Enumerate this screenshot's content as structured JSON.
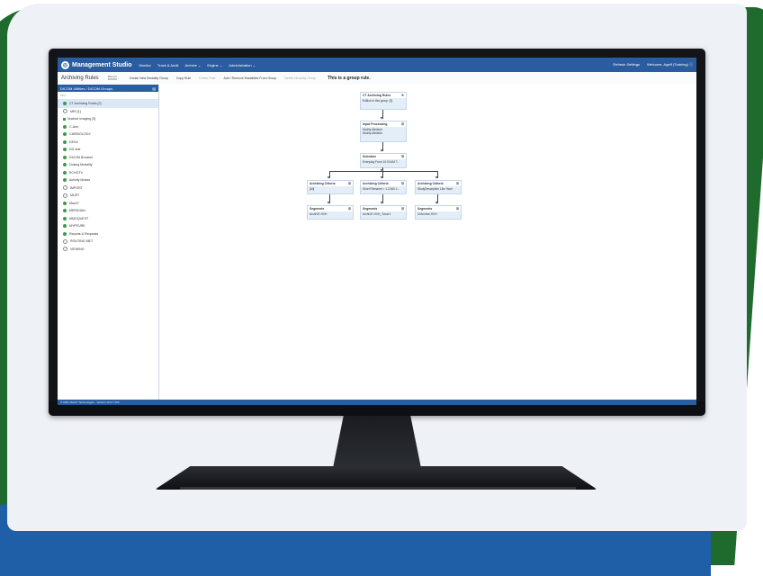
{
  "app": {
    "name": "Management Studio",
    "nav": [
      "Monitor",
      "Track & Audit",
      "Archive ⌄",
      "Engine ⌄",
      "Administration ⌄"
    ],
    "top_right": [
      "Refresh Settings",
      "Welcome, Ageff (Training) ⓘ"
    ]
  },
  "toolbar": {
    "page_title": "Archiving Rules",
    "rec_label": "Record",
    "rec_value": "DICOM",
    "buttons": [
      {
        "label": "Create New Modality Group",
        "disabled": false
      },
      {
        "label": "Copy Rule",
        "disabled": false
      },
      {
        "label": "Delete Rule",
        "disabled": true
      },
      {
        "label": "Add / Remove Modalities From Group",
        "disabled": false
      },
      {
        "label": "Delete Modality Group",
        "disabled": true
      }
    ],
    "group_title": "This is a group rule."
  },
  "sidebar": {
    "header": "DICOM Utilities / DICOM Groups",
    "filter_placeholder": "Filter",
    "items": [
      {
        "label": "CT Archiving Rules [2]",
        "state": "selected"
      },
      {
        "label": "MRI [1]",
        "state": "empty"
      },
      {
        "label": "Nuclear Imaging [3]",
        "state": "square"
      },
      {
        "label": "C-Arm",
        "state": "green"
      },
      {
        "label": "CARDIOLOGY",
        "state": "green"
      },
      {
        "label": "DEXA",
        "state": "green"
      },
      {
        "label": "DG-test",
        "state": "green"
      },
      {
        "label": "DICOM Browser",
        "state": "green"
      },
      {
        "label": "Dosing Modality",
        "state": "green"
      },
      {
        "label": "ECHOTV",
        "state": "green"
      },
      {
        "label": "Activity Modes",
        "state": "green"
      },
      {
        "label": "IMPORT",
        "state": "empty"
      },
      {
        "label": "MUST",
        "state": "empty"
      },
      {
        "label": "Mach7",
        "state": "green"
      },
      {
        "label": "MERIDIAN",
        "state": "green"
      },
      {
        "label": "MMGQUEST",
        "state": "green"
      },
      {
        "label": "MYPFURE",
        "state": "green"
      },
      {
        "label": "Reports & Requests",
        "state": "green"
      },
      {
        "label": "ROUTING MET",
        "state": "empty"
      },
      {
        "label": "VIEWING",
        "state": "empty"
      }
    ]
  },
  "flow": {
    "root": {
      "title": "CT Archiving Rules",
      "body": [
        "Edition in this group: [2]"
      ]
    },
    "input": {
      "title": "Input Processing",
      "body": [
        "Modify Attribute",
        "Modify Attribute"
      ]
    },
    "schedule": {
      "title": "Schedule",
      "body": [
        "Everyday From 10:00 AM T..."
      ]
    },
    "criteria": [
      {
        "title": "Archiving Criteria",
        "body": [
          "[All]"
        ]
      },
      {
        "title": "Archiving Criteria",
        "body": [
          "Short Filename = 1.2.840.1..."
        ]
      },
      {
        "title": "Archiving Criteria",
        "body": [
          "StudyDescription Like %ser"
        ]
      }
    ],
    "segments": [
      {
        "title": "Segments",
        "body": [
          "ArchiVE-HVH"
        ]
      },
      {
        "title": "Segments",
        "body": [
          "ArchiVE-HVH_Tower1"
        ]
      },
      {
        "title": "Segments",
        "body": [
          "CtArchive-HVH"
        ]
      }
    ]
  },
  "statusbar": "© 2021 Mach7 Technologies · Version 12.0.7.104"
}
